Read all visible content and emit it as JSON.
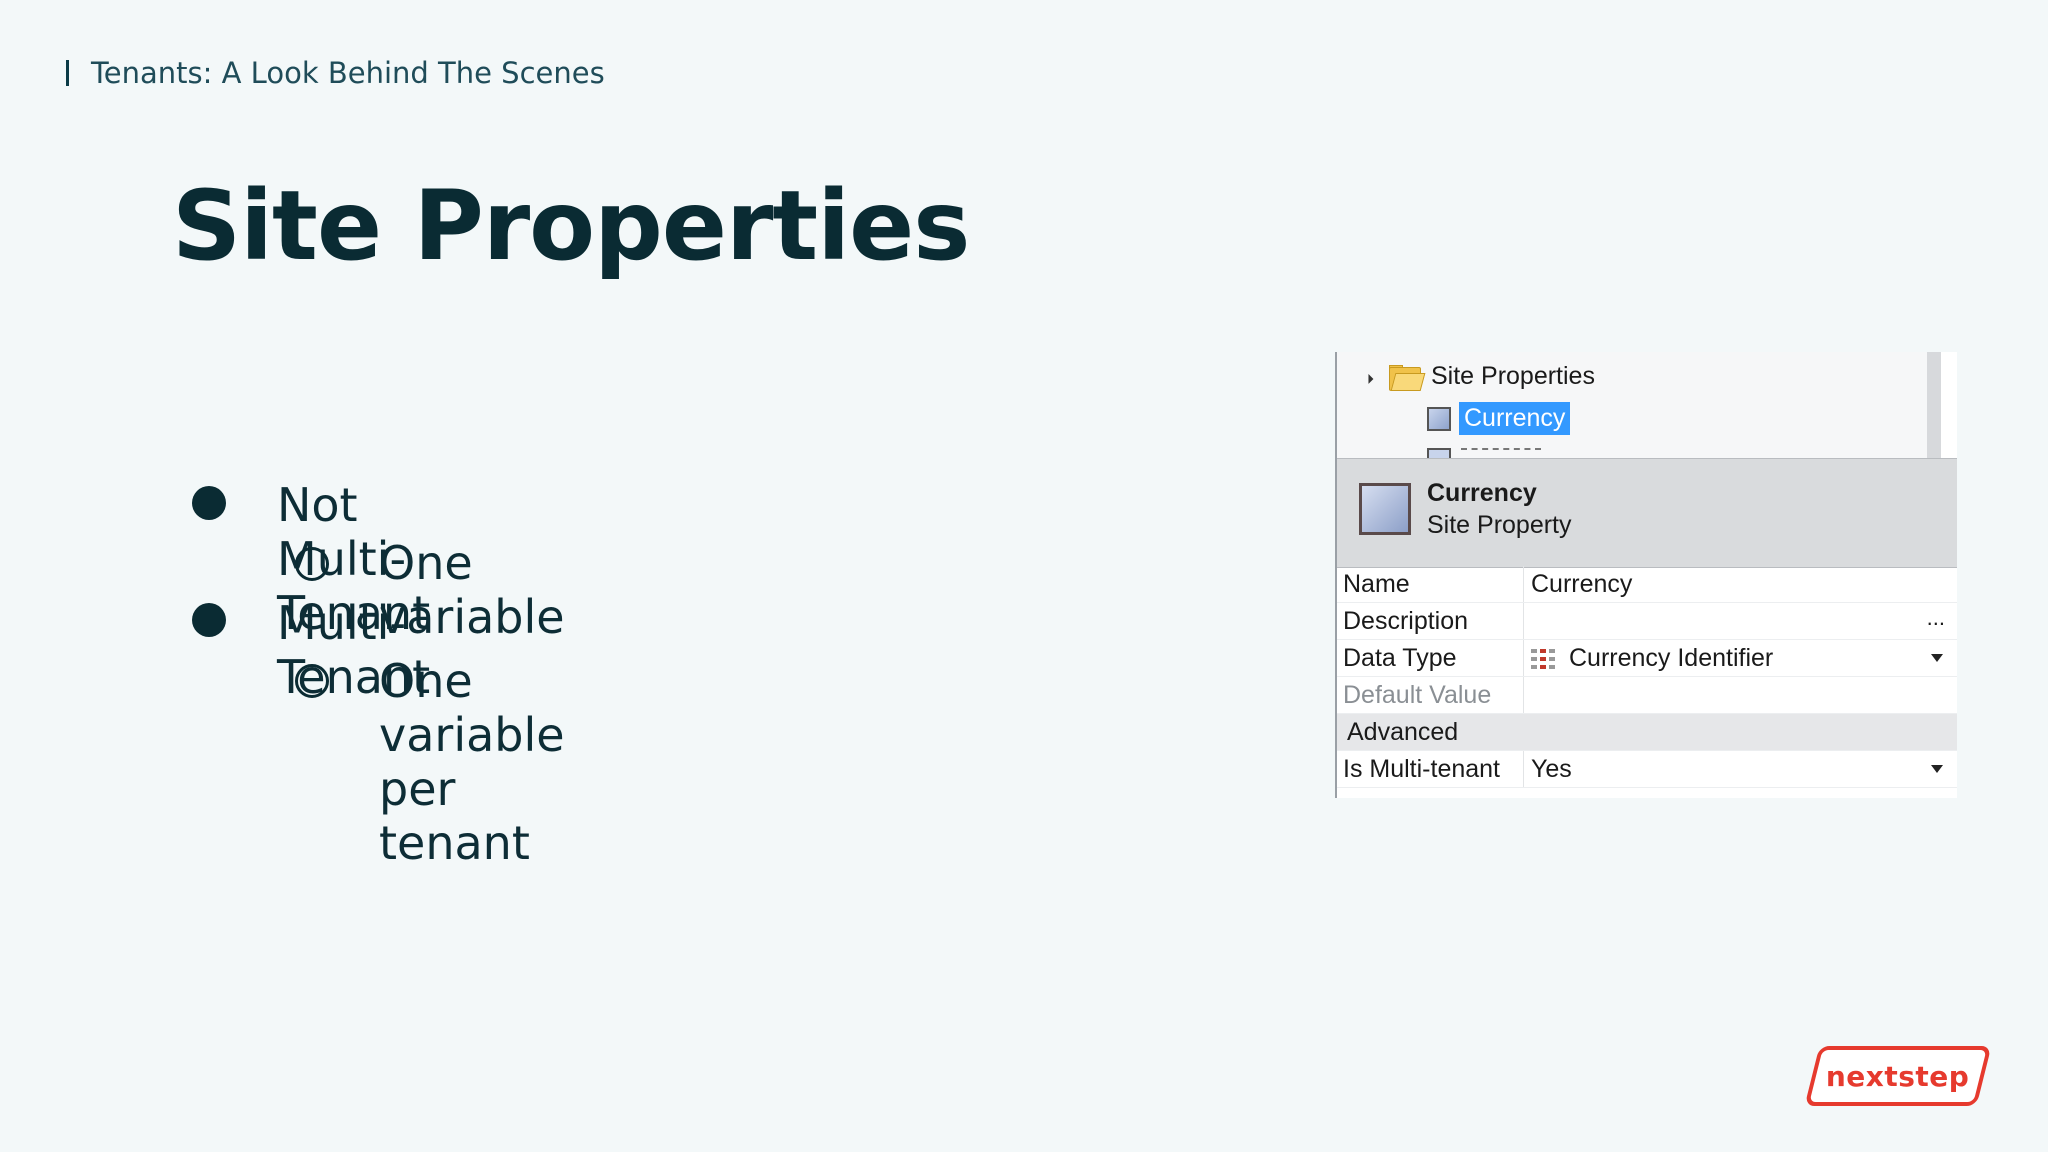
{
  "breadcrumb": "Tenants: A Look Behind The Scenes",
  "title": "Site Properties",
  "bullets": [
    {
      "text": "Not Multi-Tenant",
      "level": 1
    },
    {
      "text": "One variable",
      "level": 2
    },
    {
      "text": "Multi-Tenant",
      "level": 1
    },
    {
      "text": "One variable per tenant",
      "level": 2
    }
  ],
  "panel": {
    "tree": {
      "folder_label": "Site Properties",
      "selected_item": "Currency"
    },
    "header": {
      "name": "Currency",
      "type": "Site Property"
    },
    "properties": [
      {
        "name": "Name",
        "value": "Currency"
      },
      {
        "name": "Description",
        "value": "",
        "action": "..."
      },
      {
        "name": "Data Type",
        "value": "Currency Identifier"
      },
      {
        "name": "Default Value",
        "value": ""
      },
      {
        "section": "Advanced"
      },
      {
        "name": "Is Multi-tenant",
        "value": "Yes"
      }
    ]
  },
  "logo": "nextstep",
  "colors": {
    "background": "#f3f8f9",
    "title": "#0a2b33",
    "selection": "#3399ff",
    "logo": "#e63a2e"
  }
}
